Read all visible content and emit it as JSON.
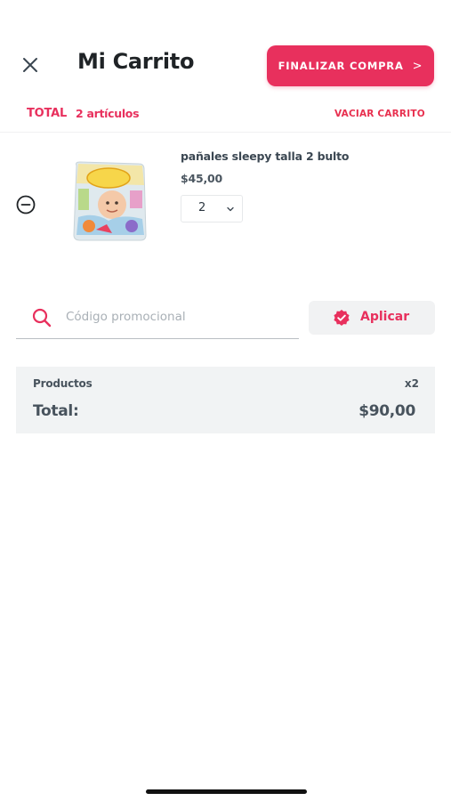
{
  "header": {
    "close_icon": "close-icon",
    "title": "Mi Carrito",
    "checkout_label": "FINALIZAR COMPRA",
    "checkout_chevron": ">"
  },
  "summary": {
    "total_label": "TOTAL",
    "items_count": "2 artículos",
    "empty_cart_label": "VACIAR CARRITO"
  },
  "cart_items": [
    {
      "name": "pañales sleepy talla 2 bulto",
      "price": "$45,00",
      "quantity": "2",
      "remove_icon": "minus-circle-icon",
      "image_icon": "diaper-package-image"
    }
  ],
  "promo": {
    "placeholder": "Código promocional",
    "value": "",
    "apply_label": "Aplicar",
    "search_icon": "search-icon",
    "apply_icon": "verified-badge-icon"
  },
  "totals": {
    "products_label": "Productos",
    "products_qty": "x2",
    "total_label": "Total:",
    "total_value": "$90,00"
  },
  "colors": {
    "accent": "#e8305d",
    "text": "#48535d",
    "panel": "#f1f3f4"
  }
}
